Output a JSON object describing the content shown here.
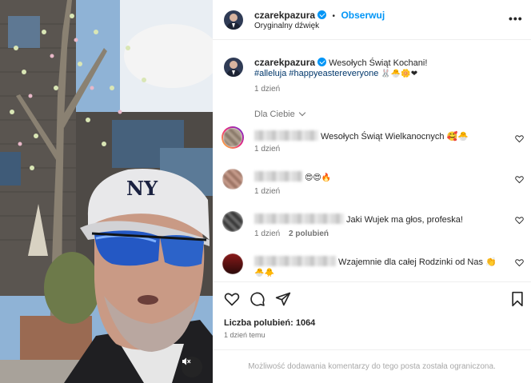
{
  "header": {
    "username": "czarekpazura",
    "separator": "•",
    "follow_label": "Obserwuj",
    "subtitle": "Oryginalny dźwięk",
    "more_icon": "ellipsis-icon"
  },
  "caption": {
    "username": "czarekpazura",
    "text": "Wesołych Świąt Kochani!",
    "hashtags": "#alleluja #happyeastereveryone",
    "emojis": "🐰🐣🌼❤",
    "time": "1 dzień"
  },
  "filter_label": "Dla Ciebie",
  "comments": [
    {
      "text": "Wesołych Świąt Wielkanocnych 🥰🐣",
      "time": "1 dzień",
      "replies": ""
    },
    {
      "text": "😍😍🔥",
      "time": "1 dzień",
      "replies": ""
    },
    {
      "text": "Jaki Wujek ma głos, profeska!",
      "time": "1 dzień",
      "replies": "2 polubień"
    },
    {
      "text": "Wzajemnie dla całej Rodzinki od Nas 👏",
      "line2": "🐣🐥",
      "time": "",
      "replies": ""
    }
  ],
  "likes": "Liczba polubień: 1064",
  "post_time": "1 dzień temu",
  "comments_disabled": "Możliwość dodawania komentarzy do tego posta została ograniczona.",
  "colors": {
    "accent": "#0095f6",
    "hashtag": "#00376b",
    "muted": "#737373"
  }
}
